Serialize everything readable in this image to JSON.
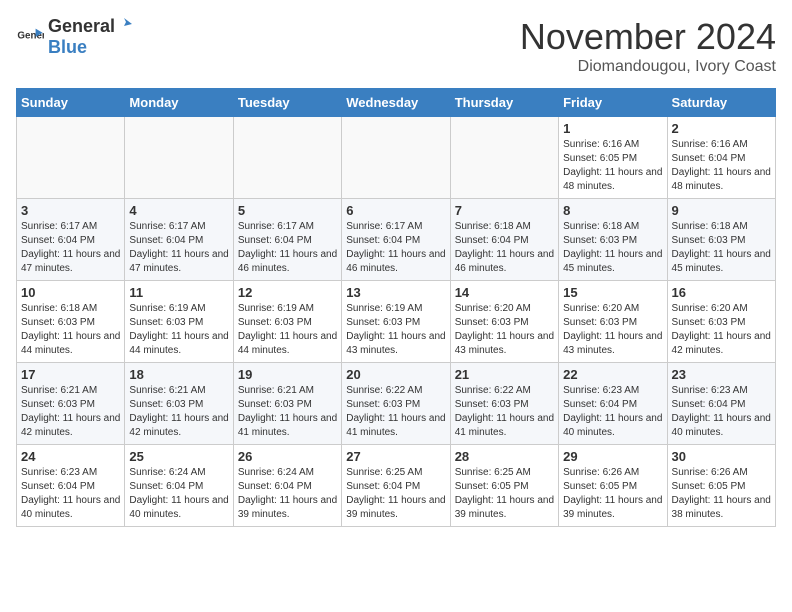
{
  "logo": {
    "general": "General",
    "blue": "Blue"
  },
  "header": {
    "month": "November 2024",
    "location": "Diomandougou, Ivory Coast"
  },
  "weekdays": [
    "Sunday",
    "Monday",
    "Tuesday",
    "Wednesday",
    "Thursday",
    "Friday",
    "Saturday"
  ],
  "weeks": [
    [
      {
        "day": "",
        "info": ""
      },
      {
        "day": "",
        "info": ""
      },
      {
        "day": "",
        "info": ""
      },
      {
        "day": "",
        "info": ""
      },
      {
        "day": "",
        "info": ""
      },
      {
        "day": "1",
        "info": "Sunrise: 6:16 AM\nSunset: 6:05 PM\nDaylight: 11 hours and 48 minutes."
      },
      {
        "day": "2",
        "info": "Sunrise: 6:16 AM\nSunset: 6:04 PM\nDaylight: 11 hours and 48 minutes."
      }
    ],
    [
      {
        "day": "3",
        "info": "Sunrise: 6:17 AM\nSunset: 6:04 PM\nDaylight: 11 hours and 47 minutes."
      },
      {
        "day": "4",
        "info": "Sunrise: 6:17 AM\nSunset: 6:04 PM\nDaylight: 11 hours and 47 minutes."
      },
      {
        "day": "5",
        "info": "Sunrise: 6:17 AM\nSunset: 6:04 PM\nDaylight: 11 hours and 46 minutes."
      },
      {
        "day": "6",
        "info": "Sunrise: 6:17 AM\nSunset: 6:04 PM\nDaylight: 11 hours and 46 minutes."
      },
      {
        "day": "7",
        "info": "Sunrise: 6:18 AM\nSunset: 6:04 PM\nDaylight: 11 hours and 46 minutes."
      },
      {
        "day": "8",
        "info": "Sunrise: 6:18 AM\nSunset: 6:03 PM\nDaylight: 11 hours and 45 minutes."
      },
      {
        "day": "9",
        "info": "Sunrise: 6:18 AM\nSunset: 6:03 PM\nDaylight: 11 hours and 45 minutes."
      }
    ],
    [
      {
        "day": "10",
        "info": "Sunrise: 6:18 AM\nSunset: 6:03 PM\nDaylight: 11 hours and 44 minutes."
      },
      {
        "day": "11",
        "info": "Sunrise: 6:19 AM\nSunset: 6:03 PM\nDaylight: 11 hours and 44 minutes."
      },
      {
        "day": "12",
        "info": "Sunrise: 6:19 AM\nSunset: 6:03 PM\nDaylight: 11 hours and 44 minutes."
      },
      {
        "day": "13",
        "info": "Sunrise: 6:19 AM\nSunset: 6:03 PM\nDaylight: 11 hours and 43 minutes."
      },
      {
        "day": "14",
        "info": "Sunrise: 6:20 AM\nSunset: 6:03 PM\nDaylight: 11 hours and 43 minutes."
      },
      {
        "day": "15",
        "info": "Sunrise: 6:20 AM\nSunset: 6:03 PM\nDaylight: 11 hours and 43 minutes."
      },
      {
        "day": "16",
        "info": "Sunrise: 6:20 AM\nSunset: 6:03 PM\nDaylight: 11 hours and 42 minutes."
      }
    ],
    [
      {
        "day": "17",
        "info": "Sunrise: 6:21 AM\nSunset: 6:03 PM\nDaylight: 11 hours and 42 minutes."
      },
      {
        "day": "18",
        "info": "Sunrise: 6:21 AM\nSunset: 6:03 PM\nDaylight: 11 hours and 42 minutes."
      },
      {
        "day": "19",
        "info": "Sunrise: 6:21 AM\nSunset: 6:03 PM\nDaylight: 11 hours and 41 minutes."
      },
      {
        "day": "20",
        "info": "Sunrise: 6:22 AM\nSunset: 6:03 PM\nDaylight: 11 hours and 41 minutes."
      },
      {
        "day": "21",
        "info": "Sunrise: 6:22 AM\nSunset: 6:03 PM\nDaylight: 11 hours and 41 minutes."
      },
      {
        "day": "22",
        "info": "Sunrise: 6:23 AM\nSunset: 6:04 PM\nDaylight: 11 hours and 40 minutes."
      },
      {
        "day": "23",
        "info": "Sunrise: 6:23 AM\nSunset: 6:04 PM\nDaylight: 11 hours and 40 minutes."
      }
    ],
    [
      {
        "day": "24",
        "info": "Sunrise: 6:23 AM\nSunset: 6:04 PM\nDaylight: 11 hours and 40 minutes."
      },
      {
        "day": "25",
        "info": "Sunrise: 6:24 AM\nSunset: 6:04 PM\nDaylight: 11 hours and 40 minutes."
      },
      {
        "day": "26",
        "info": "Sunrise: 6:24 AM\nSunset: 6:04 PM\nDaylight: 11 hours and 39 minutes."
      },
      {
        "day": "27",
        "info": "Sunrise: 6:25 AM\nSunset: 6:04 PM\nDaylight: 11 hours and 39 minutes."
      },
      {
        "day": "28",
        "info": "Sunrise: 6:25 AM\nSunset: 6:05 PM\nDaylight: 11 hours and 39 minutes."
      },
      {
        "day": "29",
        "info": "Sunrise: 6:26 AM\nSunset: 6:05 PM\nDaylight: 11 hours and 39 minutes."
      },
      {
        "day": "30",
        "info": "Sunrise: 6:26 AM\nSunset: 6:05 PM\nDaylight: 11 hours and 38 minutes."
      }
    ]
  ]
}
